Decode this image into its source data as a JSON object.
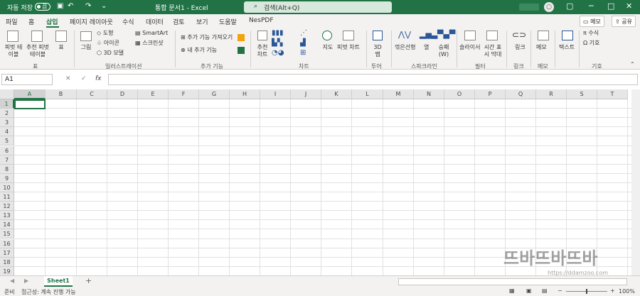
{
  "titlebar": {
    "autosave": "자동 저장",
    "toggle": "끔",
    "doc_title": "통합 문서1 - Excel",
    "search": "검색(Alt+Q)",
    "avatar": "○",
    "min": "─",
    "max": "□",
    "close": "✕",
    "restore": "▢"
  },
  "tabs": [
    "파일",
    "홈",
    "삽입",
    "페이지 레이아웃",
    "수식",
    "데이터",
    "검토",
    "보기",
    "도움말",
    "NesPDF"
  ],
  "active_tab": "삽입",
  "memo": "메모",
  "share": "공유",
  "ribbon": {
    "pivot": "피벗 테이블",
    "rec_pivot": "추천 피벗 테이블",
    "table": "표",
    "picture": "그림",
    "shapes": "도형",
    "icons": "아이콘",
    "models": "3D 모델",
    "smartart": "SmartArt",
    "screenshot": "스크린샷",
    "get_addins": "추가 기능 가져오기",
    "my_addins": "내 추가 기능",
    "rec_charts": "추천 차트",
    "maps": "지도",
    "pivot_chart": "피벗 차트",
    "map3d": "3D 맵",
    "line": "꺾은선형",
    "column": "열",
    "winloss": "승패 (W)",
    "slicer": "슬라이서",
    "timeline": "시간 표시 막대",
    "link": "링크",
    "comment": "메모",
    "text": "텍스트",
    "equation": "수식",
    "symbol": "기호",
    "groups": [
      "표",
      "일러스트레이션",
      "추가 기능",
      "차트",
      "투어",
      "스파크라인",
      "필터",
      "링크",
      "메모",
      "기호"
    ]
  },
  "formula": {
    "namebox": "A1",
    "cancel": "✕",
    "enter": "✓",
    "fx": "fx",
    "value": ""
  },
  "columns": [
    "A",
    "B",
    "C",
    "D",
    "E",
    "F",
    "G",
    "H",
    "I",
    "J",
    "K",
    "L",
    "M",
    "N",
    "O",
    "P",
    "Q",
    "R",
    "S",
    "T"
  ],
  "rows": [
    "1",
    "2",
    "3",
    "4",
    "5",
    "6",
    "7",
    "8",
    "9",
    "10",
    "11",
    "12",
    "13",
    "14",
    "15",
    "16",
    "17",
    "18",
    "19"
  ],
  "sheet": {
    "name": "Sheet1",
    "add": "+"
  },
  "status": {
    "ready": "준비",
    "accessibility": "접근성: 계속 진행 가능",
    "zoom": "100%"
  },
  "watermark": {
    "text": "뜨바뜨바뜨바",
    "url": "https://ddamzoo.com"
  }
}
